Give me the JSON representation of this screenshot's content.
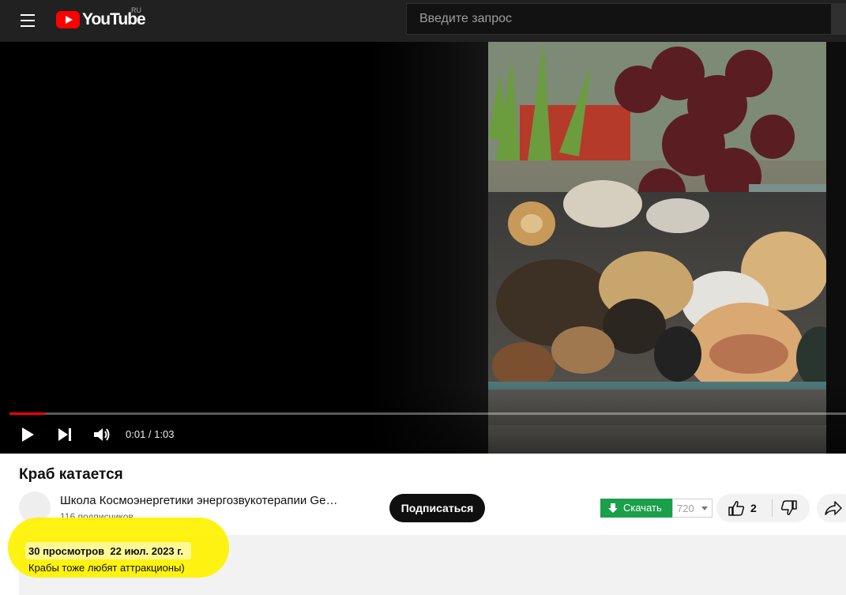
{
  "header": {
    "logo_text": "YouTube",
    "region": "RU",
    "search_placeholder": "Введите запрос"
  },
  "player": {
    "current_time": "0:01",
    "duration": "1:03",
    "time_display": "0:01 / 1:03",
    "progress_fraction": 0.016
  },
  "video": {
    "title": "Краб катается",
    "channel_name": "Школа Космоэнергетики  энергозвукотерапии  Ge…",
    "subscribers": "116 подписчиков",
    "subscribe_label": "Подписаться",
    "download_label": "Скачать",
    "quality": "720",
    "likes": "2",
    "views": "30 просмотров",
    "date": "22 июл. 2023 г.",
    "description": "Крабы тоже любят аттракционы)"
  },
  "colors": {
    "masthead": "#212121",
    "accent_red": "#ff0000",
    "download_green": "#1a9f4a",
    "highlight_yellow": "#fff200"
  }
}
